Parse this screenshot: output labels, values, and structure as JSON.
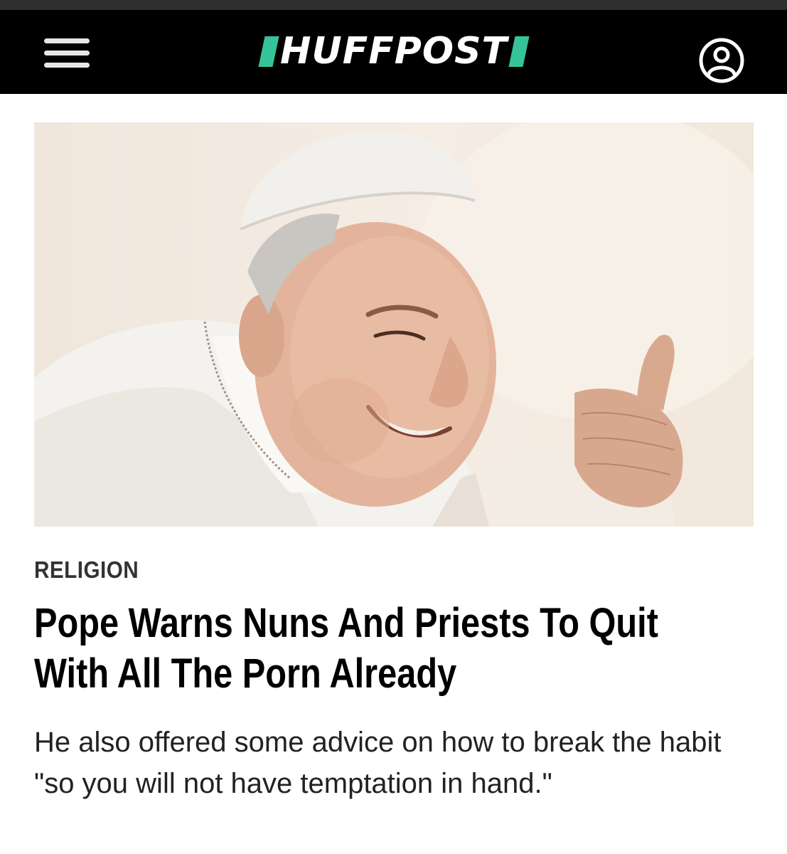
{
  "header": {
    "logo_text": "HUFFPOST",
    "menu_icon": "hamburger-menu-icon",
    "account_icon": "user-account-icon",
    "accent_color": "#35c49a",
    "background_color": "#000000"
  },
  "article": {
    "kicker": "RELIGION",
    "headline": "Pope Warns Nuns And Priests To Quit With All The Porn Already",
    "dek": "He also offered some advice on how to break the habit \"so you will not have temptation in hand.\""
  }
}
